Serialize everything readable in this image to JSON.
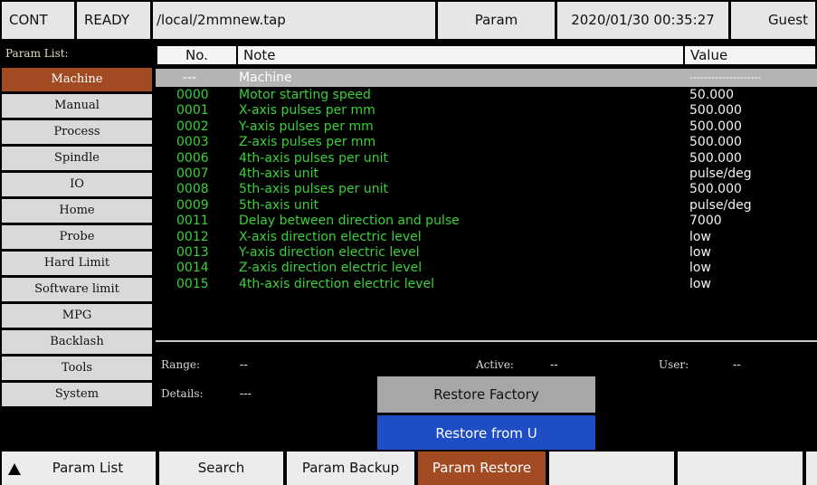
{
  "status": {
    "mode": "CONT",
    "state": "READY",
    "file": "/local/2mmnew.tap",
    "screen": "Param",
    "datetime": "2020/01/30 00:35:27",
    "user": "Guest"
  },
  "sidebar": {
    "title": "Param List:",
    "items": [
      {
        "label": "Machine",
        "active": true
      },
      {
        "label": "Manual"
      },
      {
        "label": "Process"
      },
      {
        "label": "Spindle"
      },
      {
        "label": "IO"
      },
      {
        "label": "Home"
      },
      {
        "label": "Probe"
      },
      {
        "label": "Hard Limit"
      },
      {
        "label": "Software limit"
      },
      {
        "label": "MPG"
      },
      {
        "label": "Backlash"
      },
      {
        "label": "Tools"
      },
      {
        "label": "System"
      }
    ]
  },
  "table": {
    "headers": {
      "no": "No.",
      "note": "Note",
      "value": "Value"
    },
    "section": {
      "no": "---",
      "note": "Machine",
      "value": "--------------------"
    },
    "rows": [
      {
        "no": "0000",
        "note": "Motor starting speed",
        "value": "50.000"
      },
      {
        "no": "0001",
        "note": "X-axis pulses per mm",
        "value": "500.000"
      },
      {
        "no": "0002",
        "note": "Y-axis pulses per mm",
        "value": "500.000"
      },
      {
        "no": "0003",
        "note": "Z-axis pulses per mm",
        "value": "500.000"
      },
      {
        "no": "0006",
        "note": "4th-axis pulses per unit",
        "value": "500.000"
      },
      {
        "no": "0007",
        "note": "4th-axis unit",
        "value": "pulse/deg"
      },
      {
        "no": "0008",
        "note": "5th-axis pulses per unit",
        "value": "500.000"
      },
      {
        "no": "0009",
        "note": "5th-axis unit",
        "value": "pulse/deg"
      },
      {
        "no": "0011",
        "note": "Delay between direction and pulse",
        "value": "7000"
      },
      {
        "no": "0012",
        "note": "X-axis direction electric level",
        "value": "low"
      },
      {
        "no": "0013",
        "note": "Y-axis direction electric level",
        "value": "low"
      },
      {
        "no": "0014",
        "note": "Z-axis direction electric level",
        "value": "low"
      },
      {
        "no": "0015",
        "note": "4th-axis direction electric level",
        "value": "low"
      }
    ]
  },
  "details": {
    "range_label": "Range:",
    "range_value": "--",
    "active_label": "Active:",
    "active_value": "--",
    "user_label": "User:",
    "user_value": "--",
    "details_label": "Details:",
    "details_value": "---",
    "restore_factory": "Restore Factory",
    "restore_from_u": "Restore from U"
  },
  "fkeys": [
    {
      "label": "Param List"
    },
    {
      "label": "Search"
    },
    {
      "label": "Param Backup"
    },
    {
      "label": "Param Restore",
      "active": true
    },
    {
      "label": ""
    },
    {
      "label": ""
    },
    {
      "label": ""
    }
  ],
  "colors": {
    "accent": "#a24b22",
    "button_blue": "#1f4ec4",
    "param_text": "#3ad13a"
  },
  "icons": {
    "page_up": "triangle-up-icon"
  }
}
